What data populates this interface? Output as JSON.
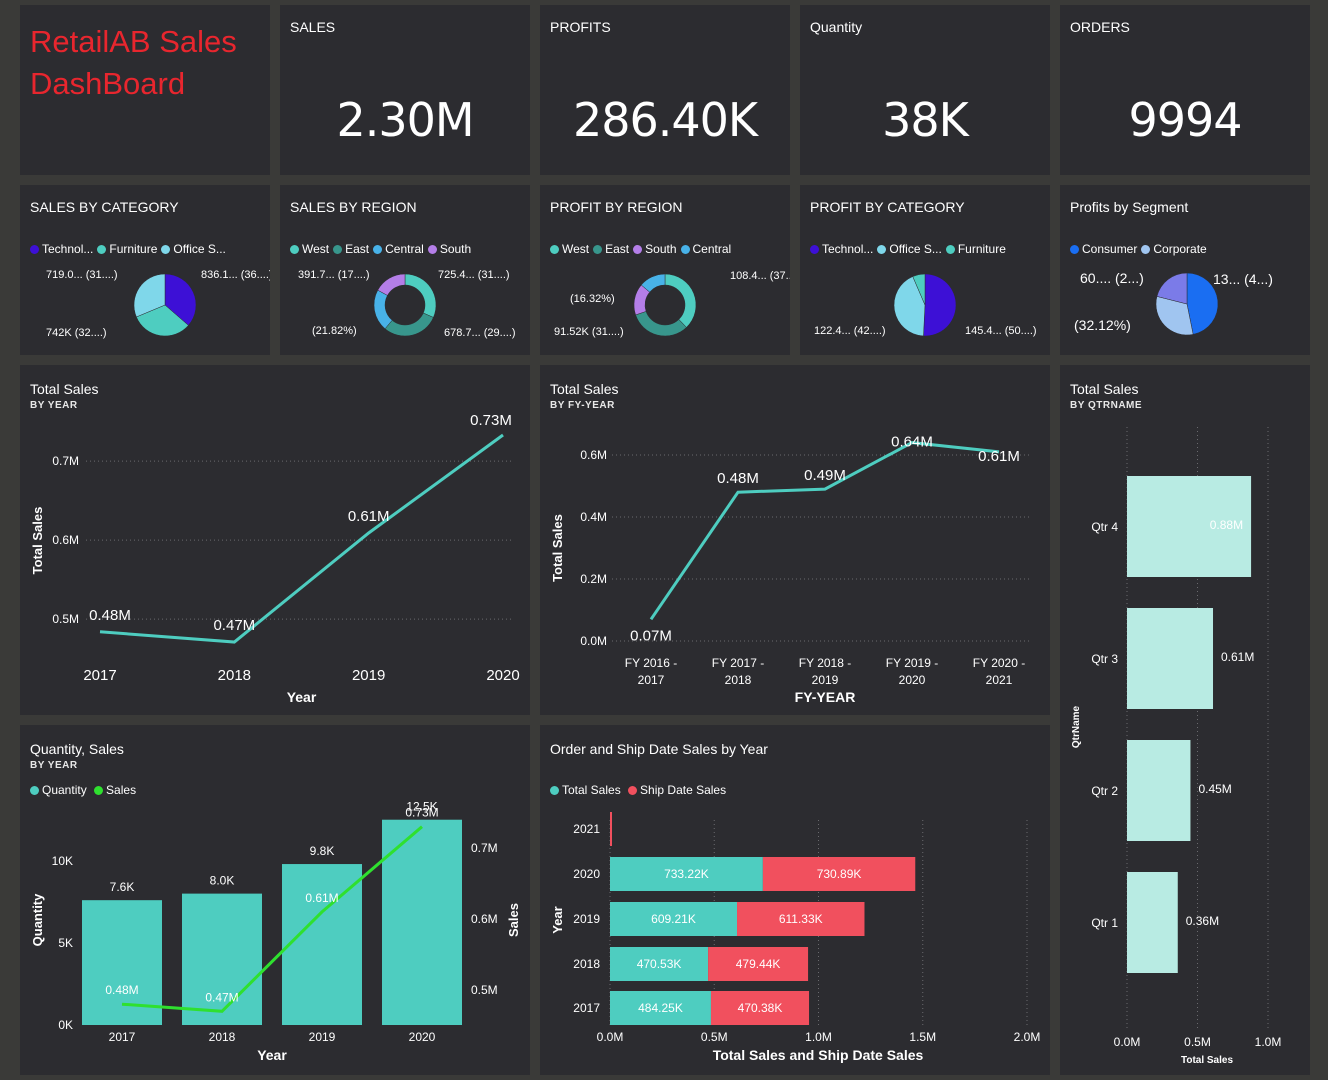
{
  "brand": {
    "line1": "RetailAB Sales",
    "line2": "DashBoard",
    "color": "#e8262e"
  },
  "kpis": [
    {
      "title": "SALES",
      "value": "2.30M"
    },
    {
      "title": "PROFITS",
      "value": "286.40K"
    },
    {
      "title": "Quantity",
      "value": "38K"
    },
    {
      "title": "ORDERS",
      "value": "9994"
    }
  ],
  "chart_data": [
    {
      "id": "sales-by-category",
      "type": "pie",
      "title": "SALES BY CATEGORY",
      "legend": [
        "Technol...",
        "Furniture",
        "Office S..."
      ],
      "colors": [
        "#3d10d6",
        "#4ecdc0",
        "#7fd7ea"
      ],
      "values": [
        836.1,
        742,
        719.0
      ],
      "labels": [
        "836.1... (36....)",
        "742K (32....)",
        "719.0... (31....)"
      ]
    },
    {
      "id": "sales-by-region",
      "type": "pie",
      "title": "SALES BY REGION",
      "legend": [
        "West",
        "East",
        "Central",
        "South"
      ],
      "colors": [
        "#4ecdc0",
        "#38968c",
        "#48b2e8",
        "#b47ee8"
      ],
      "values": [
        725.4,
        678.7,
        501.2,
        391.7
      ],
      "labels": [
        "725.4... (31....)",
        "678.7... (29....)",
        "(21.82%)",
        "391.7... (17....)"
      ]
    },
    {
      "id": "profit-by-region",
      "type": "pie",
      "title": "PROFIT BY REGION",
      "legend": [
        "West",
        "East",
        "South",
        "Central"
      ],
      "colors": [
        "#4ecdc0",
        "#38968c",
        "#b47ee8",
        "#48b2e8"
      ],
      "values": [
        108.4,
        91.52,
        46.7,
        39.7
      ],
      "labels": [
        "108.4... (37....)",
        "91.52K (31....)",
        "(16.32%)"
      ]
    },
    {
      "id": "profit-by-category",
      "type": "pie",
      "title": "PROFIT BY CATEGORY",
      "legend": [
        "Technol...",
        "Office S...",
        "Furniture"
      ],
      "colors": [
        "#3d10d6",
        "#7fd7ea",
        "#4ecdc0"
      ],
      "values": [
        145.4,
        122.4,
        18.5
      ],
      "labels": [
        "145.4... (50....)",
        "122.4... (42....)"
      ]
    },
    {
      "id": "profits-by-segment",
      "type": "pie",
      "title": "Profits by Segment",
      "legend": [
        "Consumer",
        "Corporate"
      ],
      "colors": [
        "#1a6ef2",
        "#a0c5f0",
        "#7b7be8"
      ],
      "values": [
        134.1,
        92.0,
        60.3
      ],
      "labels": [
        "13... (4...)",
        "(32.12%)",
        "60.... (2...)"
      ]
    },
    {
      "id": "total-sales-by-year",
      "type": "line",
      "title": "Total Sales",
      "subtitle": "BY YEAR",
      "xlabel": "Year",
      "ylabel": "Total Sales",
      "categories": [
        "2017",
        "2018",
        "2019",
        "2020"
      ],
      "values": [
        0.484,
        0.471,
        0.609,
        0.733
      ],
      "data_labels": [
        "0.48M",
        "0.47M",
        "0.61M",
        "0.73M"
      ],
      "y_ticks": [
        "0.5M",
        "0.6M",
        "0.7M"
      ],
      "color": "#4ecdc0"
    },
    {
      "id": "total-sales-by-fy",
      "type": "line",
      "title": "Total Sales",
      "subtitle": "BY FY-YEAR",
      "xlabel": "FY-YEAR",
      "ylabel": "Total Sales",
      "categories": [
        "FY 2016 - 2017",
        "FY 2017 - 2018",
        "FY 2018 - 2019",
        "FY 2019 - 2020",
        "FY 2020 - 2021"
      ],
      "values": [
        0.07,
        0.48,
        0.49,
        0.64,
        0.61
      ],
      "data_labels": [
        "0.07M",
        "0.48M",
        "0.49M",
        "0.64M",
        "0.61M"
      ],
      "y_ticks": [
        "0.0M",
        "0.2M",
        "0.4M",
        "0.6M"
      ],
      "ylim": [
        0,
        0.6
      ],
      "color": "#4ecdc0"
    },
    {
      "id": "total-sales-by-qtr",
      "type": "bar",
      "title": "Total Sales",
      "subtitle": "BY QTRNAME",
      "xlabel": "Total Sales",
      "ylabel": "QtrName",
      "categories": [
        "Qtr 4",
        "Qtr 3",
        "Qtr 2",
        "Qtr 1"
      ],
      "values": [
        0.88,
        0.61,
        0.45,
        0.36
      ],
      "data_labels": [
        "0.88M",
        "0.61M",
        "0.45M",
        "0.36M"
      ],
      "x_ticks": [
        "0.0M",
        "0.5M",
        "1.0M"
      ],
      "xlim": [
        0,
        1.0
      ],
      "color": "#b8ebe3"
    },
    {
      "id": "quantity-sales",
      "type": "bar",
      "title": "Quantity, Sales",
      "subtitle": "BY YEAR",
      "xlabel": "Year",
      "ylabel": "Quantity",
      "y2label": "Sales",
      "categories": [
        "2017",
        "2018",
        "2019",
        "2020"
      ],
      "series": [
        {
          "name": "Quantity",
          "values": [
            7.6,
            8.0,
            9.8,
            12.5
          ],
          "data_labels": [
            "7.6K",
            "8.0K",
            "9.8K",
            "12.5K"
          ],
          "color": "#4ecdc0"
        },
        {
          "name": "Sales",
          "values": [
            0.48,
            0.47,
            0.61,
            0.73
          ],
          "data_labels": [
            "0.48M",
            "0.47M",
            "0.61M",
            "0.73M"
          ],
          "color": "#2fe02f"
        }
      ],
      "y_ticks": [
        "0K",
        "5K",
        "10K"
      ],
      "y2_ticks": [
        "0.5M",
        "0.6M",
        "0.7M"
      ]
    },
    {
      "id": "order-ship-sales",
      "type": "bar",
      "title": "Order and Ship Date Sales by Year",
      "xlabel": "Total Sales and Ship Date Sales",
      "ylabel": "Year",
      "categories": [
        "2021",
        "2020",
        "2019",
        "2018",
        "2017"
      ],
      "series": [
        {
          "name": "Total Sales",
          "values": [
            0,
            733.22,
            609.21,
            470.53,
            484.25
          ],
          "data_labels": [
            "",
            "733.22K",
            "609.21K",
            "470.53K",
            "484.25K"
          ],
          "color": "#4ecdc0"
        },
        {
          "name": "Ship Date Sales",
          "values": [
            5,
            730.89,
            611.33,
            479.44,
            470.38
          ],
          "data_labels": [
            "",
            "730.89K",
            "611.33K",
            "479.44K",
            "470.38K"
          ],
          "color": "#f1505e"
        }
      ],
      "x_ticks": [
        "0.0M",
        "0.5M",
        "1.0M",
        "1.5M",
        "2.0M"
      ],
      "xlim": [
        0,
        2000
      ]
    }
  ]
}
